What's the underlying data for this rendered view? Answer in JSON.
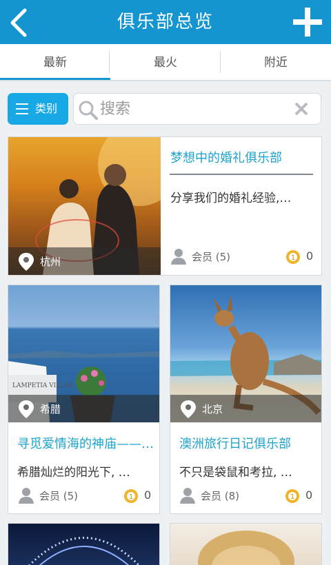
{
  "header": {
    "title": "俱乐部总览"
  },
  "tabs": [
    {
      "label": "最新"
    },
    {
      "label": "最火"
    },
    {
      "label": "附近"
    }
  ],
  "category_button": {
    "label": "类别"
  },
  "search": {
    "placeholder": "搜索"
  },
  "clubs": [
    {
      "title": "梦想中的婚礼俱乐部",
      "desc": "分享我们的婚礼经验,…",
      "location": "杭州",
      "members": "会员 (5)",
      "count": "0"
    },
    {
      "title": "寻觅爱情海的神庙——…",
      "desc": "希腊灿烂的阳光下, …",
      "location": "希腊",
      "members": "会员 (5)",
      "count": "0"
    },
    {
      "title": "澳洲旅行日记俱乐部",
      "desc": "不只是袋鼠和考拉, …",
      "location": "北京",
      "members": "会员 (8)",
      "count": "0"
    }
  ],
  "colors": {
    "accent": "#1595cf",
    "title_text": "#1da3cc"
  }
}
